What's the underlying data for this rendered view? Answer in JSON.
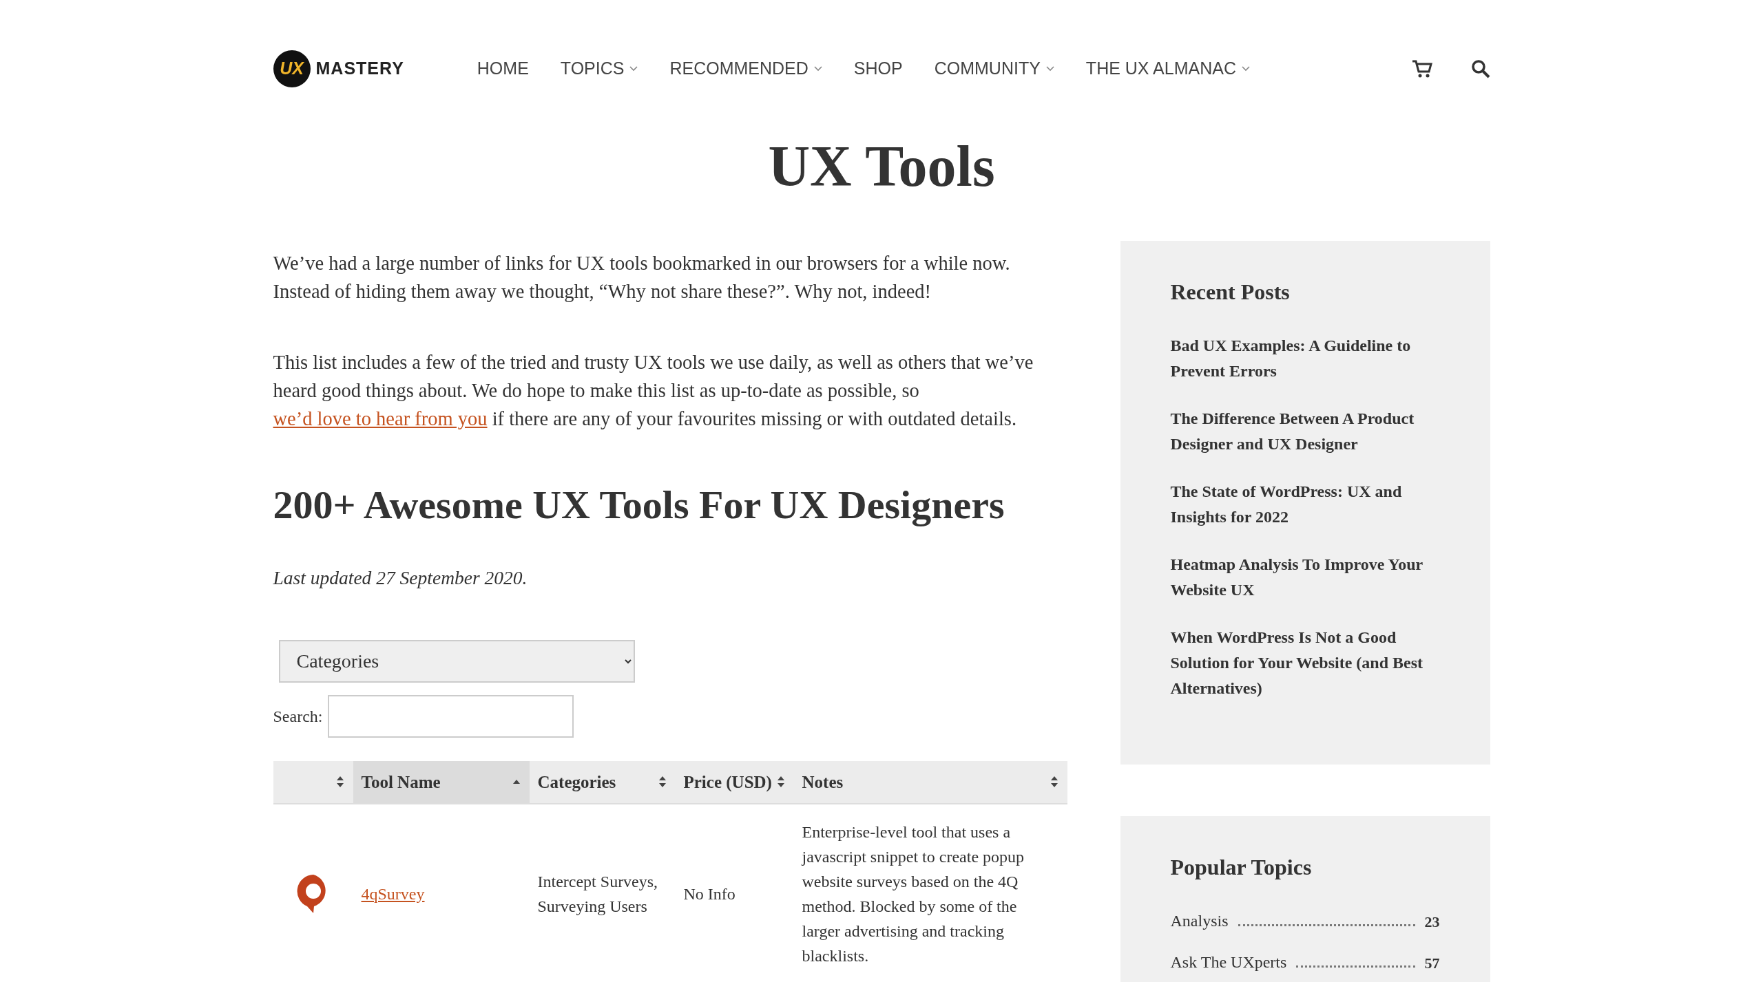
{
  "logo": {
    "badge": "UX",
    "text": "MASTERY"
  },
  "nav": [
    {
      "label": "HOME",
      "dropdown": false
    },
    {
      "label": "TOPICS",
      "dropdown": true
    },
    {
      "label": "RECOMMENDED",
      "dropdown": true
    },
    {
      "label": "SHOP",
      "dropdown": false
    },
    {
      "label": "COMMUNITY",
      "dropdown": true
    },
    {
      "label": "THE UX ALMANAC",
      "dropdown": true
    }
  ],
  "page_title": "UX Tools",
  "intro": [
    {
      "before": "We’ve had a large number of links for UX tools bookmarked in our browsers for a while now. Instead of hiding them away we thought, “Why not share these?”. Why not, indeed!"
    },
    {
      "before": "This list includes a few of the tried and trusty UX tools we use daily, as well as others that we’ve heard good things about. We do hope to make this list as up-to-date as possible, so ",
      "link": "we’d love to hear from you",
      "after": " if there are any of your favourites missing or with outdated details."
    }
  ],
  "heading": "200+ Awesome UX Tools For UX Designers",
  "updated": "Last updated 27 September 2020.",
  "category_select": {
    "value": "Categories"
  },
  "search": {
    "label": "Search:"
  },
  "table": {
    "columns": [
      {
        "sorted": false
      },
      {
        "label": "Tool Name",
        "sorted": true
      },
      {
        "label": "Categories",
        "sorted": false
      },
      {
        "label": "Price (USD)",
        "sorted": false
      },
      {
        "label": "Notes",
        "sorted": false
      }
    ],
    "rows": [
      {
        "name": "4qSurvey",
        "categories": "Intercept Surveys, Surveying Users",
        "price": "No Info",
        "notes": "Enterprise-level tool that uses a javascript snippet to create popup website surveys based on the 4Q method. Blocked by some of the larger advertising and tracking blacklists."
      }
    ]
  },
  "sidebar": {
    "recent_posts": {
      "title": "Recent Posts",
      "items": [
        "Bad UX Examples: A Guideline to Prevent Errors",
        "The Difference Between A Product Designer and UX Designer",
        "The State of WordPress: UX and Insights for 2022",
        "Heatmap Analysis To Improve Your Website UX",
        "When WordPress Is Not a Good Solution for Your Website (and Best Alternatives)"
      ]
    },
    "popular_topics": {
      "title": "Popular Topics",
      "items": [
        {
          "name": "Analysis",
          "count": "23"
        },
        {
          "name": "Ask The UXperts",
          "count": "57"
        }
      ]
    }
  }
}
